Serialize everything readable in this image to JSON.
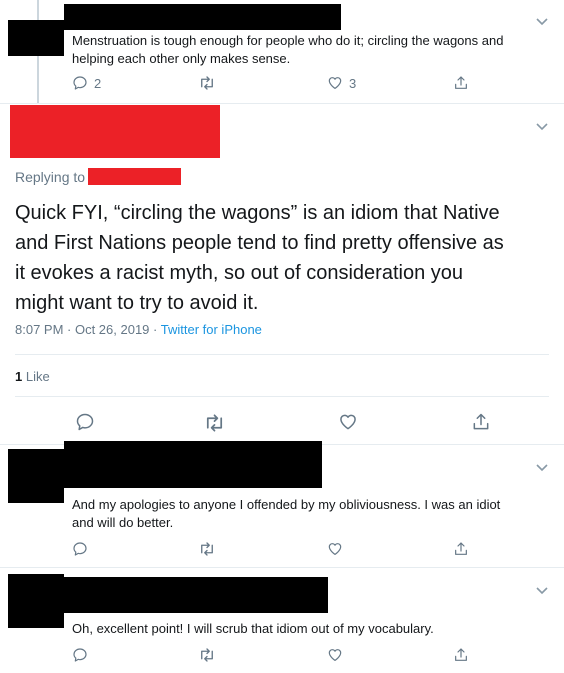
{
  "colors": {
    "accent": "#1b95e0",
    "muted": "#657786",
    "redact_red": "#ec2127",
    "divider": "#e6ecf0"
  },
  "tweet_top": {
    "text_line1": "Menstruation is tough enough for people who do it; circling the wagons and",
    "text_line2": "helping each other only makes sense.",
    "reply_count": "2",
    "like_count": "3"
  },
  "tweet_main": {
    "replying_to_label": "Replying to",
    "text_line1": "Quick FYI, “circling the wagons” is an idiom that Native",
    "text_line2": "and First Nations people tend to find pretty offensive as",
    "text_line3": "it evokes a racist myth, so out of consideration you",
    "text_line4": "might want to try to avoid it.",
    "timestamp": "8:07 PM · Oct 26, 2019 ·",
    "source": "Twitter for iPhone",
    "likes_count": "1",
    "likes_label": "Like"
  },
  "reply_1": {
    "text_line1": "And my apologies to anyone I offended by my obliviousness.  I was an idiot",
    "text_line2": "and will do better."
  },
  "reply_2": {
    "text_line1": "Oh, excellent point!  I will scrub that idiom out of my vocabulary."
  },
  "icons": [
    "chevron-down-icon",
    "reply-icon",
    "retweet-icon",
    "like-icon",
    "share-icon"
  ]
}
